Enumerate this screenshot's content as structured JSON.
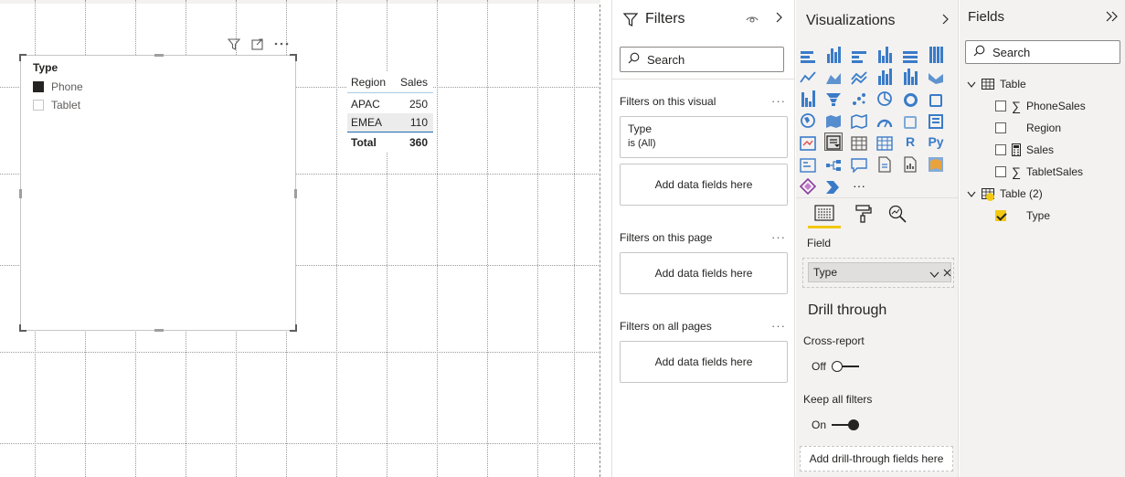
{
  "canvas": {
    "slicer": {
      "title": "Type",
      "items": [
        {
          "label": "Phone",
          "checked": true
        },
        {
          "label": "Tablet",
          "checked": false
        }
      ]
    },
    "visual_header_icons": [
      "filter-icon",
      "focus-mode-icon",
      "more-options-icon"
    ],
    "table": {
      "headers": [
        "Region",
        "Sales"
      ],
      "rows": [
        [
          "APAC",
          "250"
        ],
        [
          "EMEA",
          "110"
        ]
      ],
      "total": [
        "Total",
        "360"
      ]
    }
  },
  "filters_pane": {
    "title": "Filters",
    "search_placeholder": "Search",
    "sections": [
      {
        "label": "Filters on this visual"
      },
      {
        "label": "Filters on this page"
      },
      {
        "label": "Filters on all pages"
      }
    ],
    "visual_filter_card": {
      "field": "Type",
      "condition": "is (All)"
    },
    "drop_text": "Add data fields here",
    "more": "···"
  },
  "visualizations_pane": {
    "title": "Visualizations",
    "field_label": "Field",
    "field_value": "Type",
    "drill_through_title": "Drill through",
    "cross_report_label": "Cross-report",
    "cross_report_state": "Off",
    "keep_filters_label": "Keep all filters",
    "keep_filters_state": "On",
    "drill_button": "Add drill-through fields here",
    "more_glyph": "···",
    "r_label": "R",
    "py_label": "Py",
    "accent": "#f2c811"
  },
  "fields_pane": {
    "title": "Fields",
    "search_placeholder": "Search",
    "tables": [
      {
        "name": "Table",
        "fields": [
          {
            "label": "PhoneSales",
            "icon": "sigma-icon",
            "checked": false
          },
          {
            "label": "Region",
            "icon": "",
            "checked": false
          },
          {
            "label": "Sales",
            "icon": "calculator-icon",
            "checked": false
          },
          {
            "label": "TabletSales",
            "icon": "sigma-icon",
            "checked": false
          }
        ]
      },
      {
        "name": "Table (2)",
        "fields": [
          {
            "label": "Type",
            "icon": "",
            "checked": true
          }
        ]
      }
    ]
  }
}
